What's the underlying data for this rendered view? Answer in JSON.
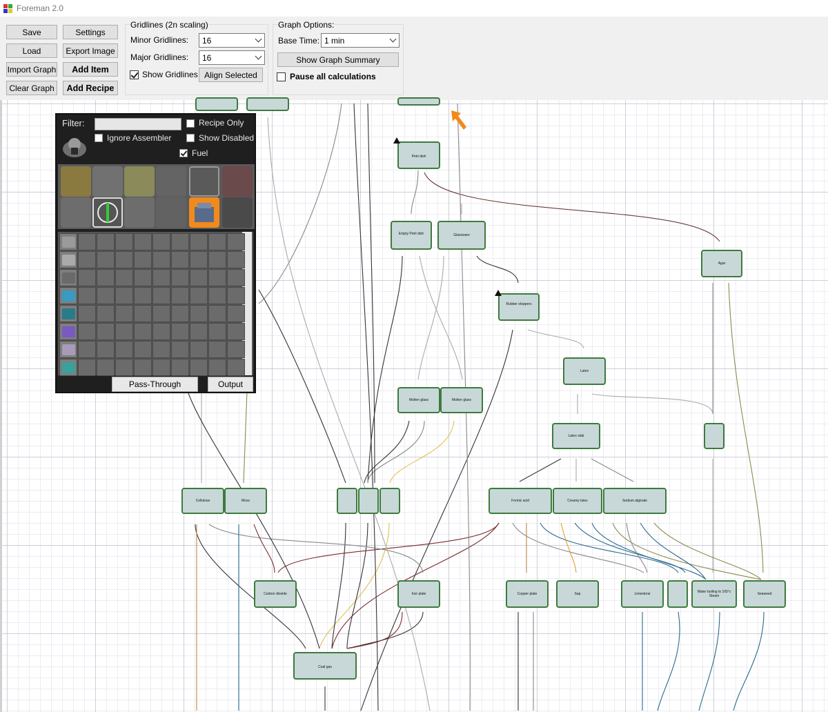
{
  "window": {
    "title": "Foreman 2.0"
  },
  "toolbar": {
    "save": "Save",
    "settings": "Settings",
    "load": "Load",
    "export_image": "Export Image",
    "import_graph": "Import Graph",
    "add_item": "Add Item",
    "clear_graph": "Clear Graph",
    "add_recipe": "Add Recipe"
  },
  "gridlines": {
    "title": "Gridlines (2n scaling)",
    "minor_label": "Minor Gridlines:",
    "minor_value": "16",
    "major_label": "Major Gridlines:",
    "major_value": "16",
    "show_label": "Show Gridlines",
    "show_checked": true,
    "align_selected": "Align Selected"
  },
  "graph_options": {
    "title": "Graph Options:",
    "base_time_label": "Base Time:",
    "base_time_value": "1 min",
    "show_summary": "Show Graph Summary",
    "pause_label": "Pause all calculations",
    "pause_checked": false
  },
  "chooser": {
    "filter_label": "Filter:",
    "filter_value": "",
    "recipe_only": "Recipe Only",
    "ignore_assembler": "Ignore Assembler",
    "show_disabled": "Show Disabled",
    "fuel": "Fuel",
    "fuel_checked": true,
    "pass_through": "Pass-Through",
    "output": "Output"
  },
  "nodes": {
    "petri_dish": "Petri dish",
    "empty_petri": "Empty Petri dish",
    "glassware": "Glassware",
    "rubber_stoppers": "Rubber stoppers",
    "agar": "Agar",
    "latex": "Latex",
    "molten_glass_1": "Molten glass",
    "molten_glass_2": "Molten glass",
    "latex_slab": "Latex slab",
    "cellulose": "Cellulose",
    "moss": "Moss",
    "formic_acid": "Formic acid",
    "creamy_latex": "Creamy latex",
    "sodium_alginate": "Sodium alginate",
    "carbon_dioxide": "Carbon dioxide",
    "iron_plate": "Iron plate",
    "copper_plate": "Copper plate",
    "sap": "Sap",
    "limestone": "Limestone",
    "water_boiling": "Water boiling to 165°c Steam",
    "seaweed": "Seaweed",
    "coal_gas": "Coal gas"
  },
  "colors": {
    "node_fill": "#c8d8d8",
    "node_border": "#3d7a3d",
    "accent_orange": "#f08a1c"
  }
}
